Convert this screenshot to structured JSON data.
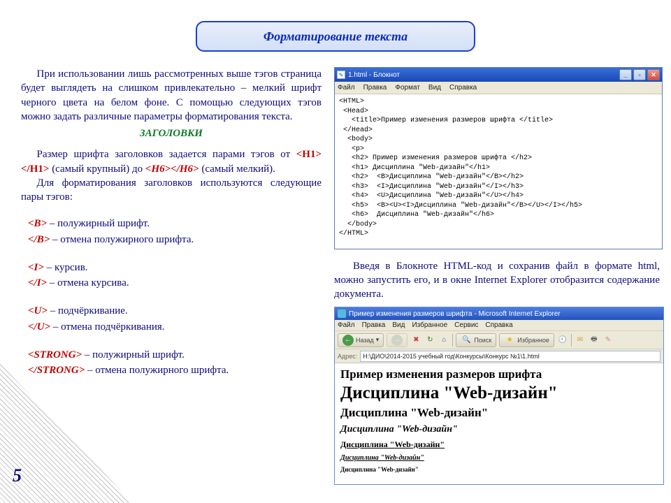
{
  "banner": {
    "title": "Форматирование текста"
  },
  "left": {
    "p1": "При использовании лишь рассмотренных выше тэгов страница будет выглядеть на слишком привлекательно – мелкий шрифт черного цвета на белом фоне. С помощью следующих тэгов можно задать различные параметры форматирования текста.",
    "headings_label": "ЗАГОЛОВКИ",
    "p2a": "Размер шрифта заголовков задается парами тэгов от ",
    "h1tag": "<H1></H1>",
    "p2b": " (самый крупный) до ",
    "h6tag": "<H6></H6>",
    "p2c": " (самый мелкий).",
    "p3": "Для форматирования заголовков используются следующие пары тэгов:",
    "tags": {
      "b_open": "<B>",
      "b_open_desc": " – полужирный шрифт.",
      "b_close": "</B>",
      "b_close_desc": " – отмена полужирного шрифта.",
      "i_open": "<I>",
      "i_open_desc": " – курсив.",
      "i_close": "</I>",
      "i_close_desc": " – отмена курсива.",
      "u_open": "<U>",
      "u_open_desc": " – подчёркивание.",
      "u_close": "</U>",
      "u_close_desc": " – отмена подчёркивания.",
      "s_open": "<STRONG>",
      "s_open_desc": " – полужирный шрифт.",
      "s_close": "</STRONG>",
      "s_close_desc": " –  отмена полужирного шрифта."
    }
  },
  "notepad": {
    "title": "1.html - Блокнот",
    "menu": {
      "file": "Файл",
      "edit": "Правка",
      "format": "Формат",
      "view": "Вид",
      "help": "Справка"
    },
    "code": "<HTML>\n <Head>\n   <title>Пример изменения размеров шрифта </title>\n </Head>\n  <body>\n   <p>\n   <h2> Пример изменения размеров шрифта </h2>\n   <h1> Дисциплина \"Web-дизайн\"</h1>\n   <h2>  <B>Дисциплина \"Web-дизайн\"</B></h2>\n   <h3>  <I>Дисциплина \"Web-дизайн\"</I></h3>\n   <h4>  <U>Дисциплина \"Web-дизайн\"</U></h4>\n   <h5>  <B><U><I>Дисциплина \"Web-дизайн\"</B></U></I></h5>\n   <h6>  Дисциплина \"Web-дизайн\"</h6>\n  </body>\n</HTML>"
  },
  "right_text": "Введя в Блокноте HTML-код и сохранив файл в формате html, можно запустить его, и в окне Internet Explorer отобразится содержание документа.",
  "ie": {
    "title": "Пример изменения размеров шрифта - Microsoft Internet Explorer",
    "menu": {
      "file": "Файл",
      "edit": "Правка",
      "view": "Вид",
      "fav": "Избранное",
      "tools": "Сервис",
      "help": "Справка"
    },
    "toolbar": {
      "back": "Назад",
      "search": "Поиск",
      "fav": "Избранное"
    },
    "addr_label": "Адрес:",
    "addr": "H:\\ДИО\\2014-2015 учебный год\\Конкурсы\\Конкурс №1\\1.html",
    "body": {
      "h2": "Пример изменения размеров шрифта",
      "h1": "Дисциплина \"Web-дизайн\"",
      "h2b": "Дисциплина \"Web-дизайн\"",
      "h3": "Дисциплина \"Web-дизайн\"",
      "h4": "Дисциплина \"Web-дизайн\"",
      "h5": "Дисциплина \"Web-дизайн\"",
      "h6": "Дисциплина \"Web-дизайн\""
    }
  },
  "page_number": "5"
}
